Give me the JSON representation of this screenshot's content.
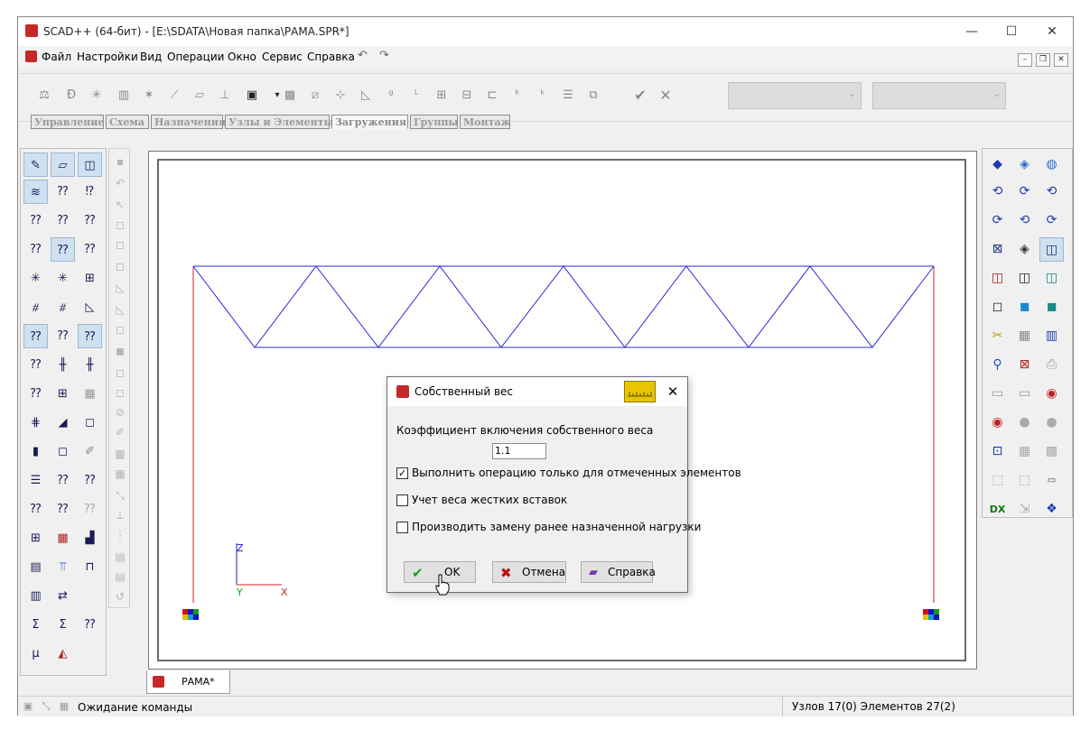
{
  "window": {
    "title": "SCAD++ (64-бит) - [E:\\SDATA\\Новая папка\\РАМА.SPR*]",
    "minimize": "—",
    "maximize": "☐",
    "close": "✕"
  },
  "menu": [
    "Файл",
    "Настройки",
    "Вид",
    "Операции",
    "Окно",
    "Сервис",
    "Справка"
  ],
  "toolbar": {
    "apply_icon": "✔",
    "cancel_icon": "✕",
    "combo1_value": "",
    "combo2_value": ""
  },
  "tabs": [
    "Управление",
    "Схема",
    "Назначения",
    "Узлы и Элементы",
    "Загружения",
    "Группы",
    "Монтаж"
  ],
  "active_tab": "Загружения",
  "axes": {
    "z": "Z",
    "y": "Y",
    "x": "X"
  },
  "document_tab": "РАМА*",
  "status": {
    "left": "Ожидание команды",
    "right": "Узлов 17(0) Элементов 27(2)"
  },
  "dialog": {
    "title": "Собственный вес",
    "close": "✕",
    "coef_label": "Коэффициент включения собственного веса",
    "coef_value": "1.1",
    "options": [
      {
        "label": "Выполнить операцию только для отмеченных элементов",
        "checked": true
      },
      {
        "label": "Учет веса жестких вставок",
        "checked": false
      },
      {
        "label": "Производить замену ранее назначенной нагрузки",
        "checked": false
      }
    ],
    "buttons": {
      "ok": "OK",
      "cancel": "Отмена",
      "help": "Справка"
    }
  },
  "colors": {
    "truss": "#2b2bd6",
    "columns": "#cc2020",
    "axis_z_y": "#1a1ad0",
    "axis_x": "#d02020"
  }
}
